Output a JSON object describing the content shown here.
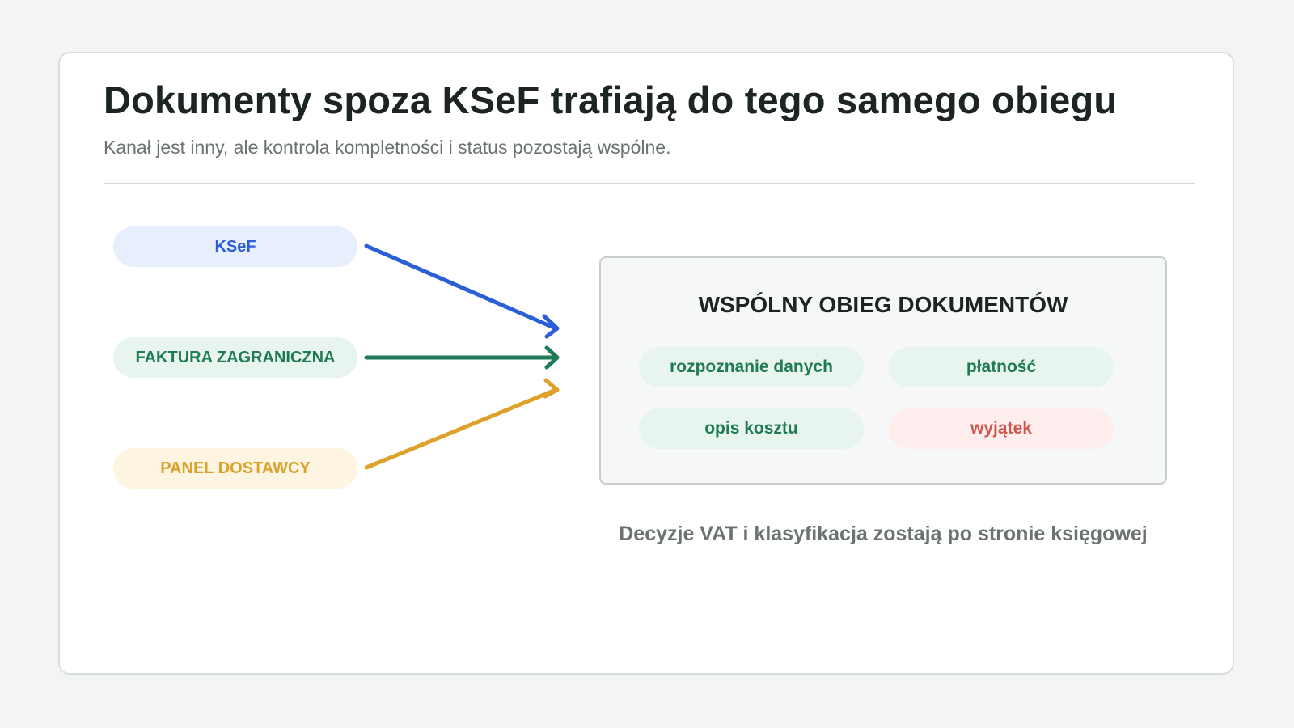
{
  "header": {
    "title": "Dokumenty spoza KSeF trafiają do tego samego obiegu",
    "subtitle": "Kanał jest inny, ale kontrola kompletności i status pozostają wspólne."
  },
  "sources": [
    {
      "label": "KSeF",
      "text_color": "#2c5fd6",
      "bg_color": "#e8effc",
      "arrow_color": "#2c5fd6"
    },
    {
      "label": "FAKTURA ZAGRANICZNA",
      "text_color": "#1f7a57",
      "bg_color": "#e8f4ee",
      "arrow_color": "#1f7a57"
    },
    {
      "label": "PANEL DOSTAWCY",
      "text_color": "#dba22c",
      "bg_color": "#fdf4e2",
      "arrow_color": "#dea22c"
    }
  ],
  "hub": {
    "title": "WSPÓLNY OBIEG DOKUMENTÓW",
    "steps": [
      {
        "label": "rozpoznanie danych",
        "text_color": "#1f7a57",
        "bg_color": "#e8f4ee"
      },
      {
        "label": "płatność",
        "text_color": "#1f7a57",
        "bg_color": "#e8f4ee"
      },
      {
        "label": "opis kosztu",
        "text_color": "#1f7a57",
        "bg_color": "#e8f4ee"
      },
      {
        "label": "wyjątek",
        "text_color": "#d0564f",
        "bg_color": "#fdeeed"
      }
    ]
  },
  "footnote": "Decyzje VAT i klasyfikacja zostają po stronie księgowej"
}
